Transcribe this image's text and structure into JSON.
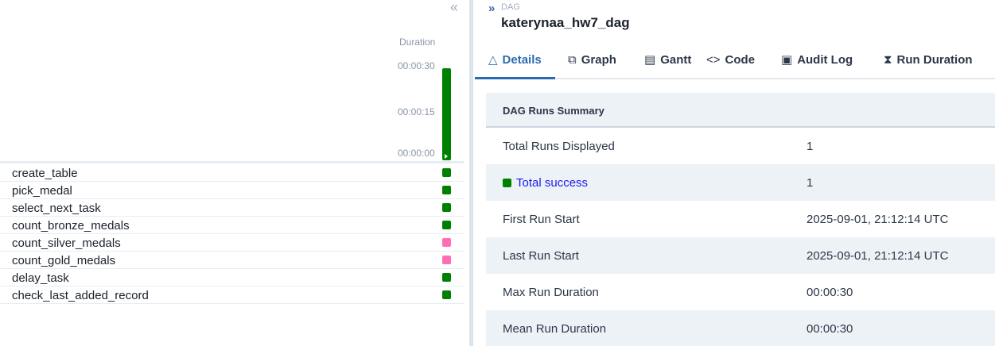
{
  "left": {
    "collapse_icon": "«",
    "duration_label": "Duration",
    "ticks": [
      "00:00:30",
      "00:00:15",
      "00:00:00"
    ],
    "run": {
      "duration_fraction": 1.0,
      "status": "success",
      "play_icon": "play-icon"
    },
    "tasks": [
      {
        "name": "create_table",
        "status": "success"
      },
      {
        "name": "pick_medal",
        "status": "success"
      },
      {
        "name": "select_next_task",
        "status": "success"
      },
      {
        "name": "count_bronze_medals",
        "status": "success"
      },
      {
        "name": "count_silver_medals",
        "status": "skipped"
      },
      {
        "name": "count_gold_medals",
        "status": "skipped"
      },
      {
        "name": "delay_task",
        "status": "success"
      },
      {
        "name": "check_last_added_record",
        "status": "success"
      }
    ]
  },
  "colors": {
    "success": "#008000",
    "skipped": "#ff6eb4",
    "accent": "#2b6cb0"
  },
  "header": {
    "expand_icon": "»",
    "dag_label": "DAG",
    "dag_id": "katerynaa_hw7_dag"
  },
  "tabs": [
    {
      "label": "Details",
      "icon": "△"
    },
    {
      "label": "Graph",
      "icon": "⧉"
    },
    {
      "label": "Gantt",
      "icon": "▤"
    },
    {
      "label": "Code",
      "icon": "<>"
    },
    {
      "label": "Audit Log",
      "icon": "▣"
    },
    {
      "label": "Run Duration",
      "icon": "⧗"
    }
  ],
  "summary": {
    "title": "DAG Runs Summary",
    "rows": [
      {
        "label": "Total Runs Displayed",
        "value": "1"
      },
      {
        "label": "Total success",
        "value": "1"
      },
      {
        "label": "First Run Start",
        "value": "2025-09-01, 21:12:14 UTC"
      },
      {
        "label": "Last Run Start",
        "value": "2025-09-01, 21:12:14 UTC"
      },
      {
        "label": "Max Run Duration",
        "value": "00:00:30"
      },
      {
        "label": "Mean Run Duration",
        "value": "00:00:30"
      }
    ]
  }
}
